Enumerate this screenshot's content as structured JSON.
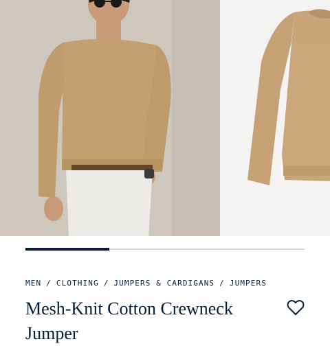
{
  "gallery": {
    "images": [
      {
        "alt": "model-wearing-sweater"
      },
      {
        "alt": "sweater-product-flat"
      }
    ],
    "progress": 0.3
  },
  "breadcrumb": {
    "items": [
      "MEN",
      "CLOTHING",
      "JUMPERS & CARDIGANS",
      "JUMPERS"
    ],
    "separator": "/"
  },
  "product": {
    "title": "Mesh-Knit Cotton Crewneck Jumper"
  },
  "colors": {
    "navy": "#041e3a",
    "camel": "#c49f6e",
    "track": "#d9d9d9"
  }
}
